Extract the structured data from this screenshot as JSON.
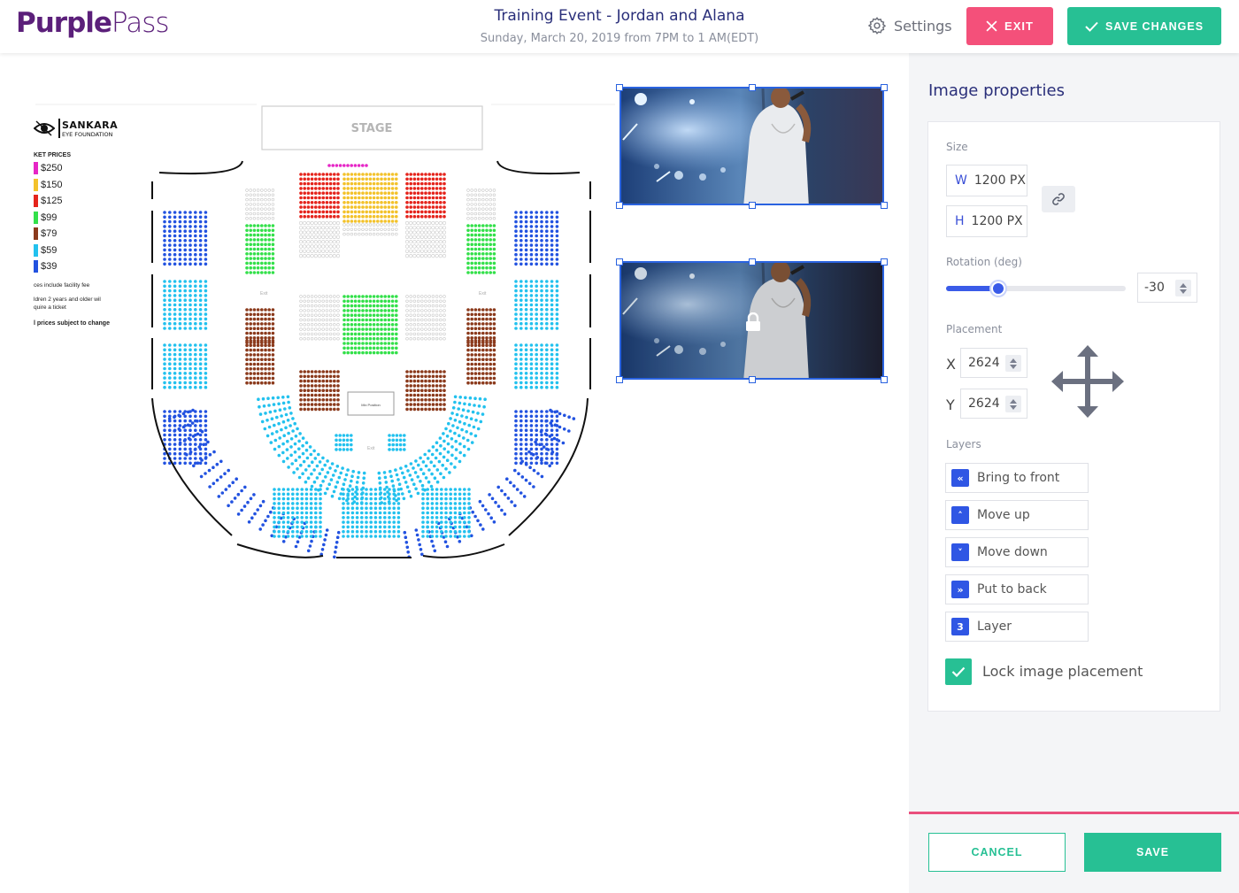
{
  "header": {
    "logo_part1": "Purple",
    "logo_part2": "Pass",
    "event_title": "Training Event - Jordan and Alana",
    "event_subtitle": "Sunday, March 20, 2019 from 7PM to 1 AM(EDT)",
    "settings_label": "Settings",
    "exit_label": "EXIT",
    "save_changes_label": "SAVE CHANGES"
  },
  "map": {
    "stage_label": "STAGE",
    "org_name": "SANKARA",
    "org_sub": "EYE FOUNDATION",
    "prices_heading": "KET PRICES",
    "price_tiers": [
      {
        "label": "$250",
        "color": "#e626c6"
      },
      {
        "label": "$150",
        "color": "#f3c22b"
      },
      {
        "label": "$125",
        "color": "#e5241c"
      },
      {
        "label": "$99",
        "color": "#33e04a"
      },
      {
        "label": "$79",
        "color": "#8b3a1c"
      },
      {
        "label": "$59",
        "color": "#22c1ee"
      },
      {
        "label": "$39",
        "color": "#2252e0"
      }
    ],
    "note1": "ces include facility fee",
    "note2a": "ldren 2 years and older wil",
    "note2b": "quire a ticket",
    "note3": "l prices subject to change",
    "mix_position": "Mix Position",
    "exit_labels": [
      "Exit",
      "Exit",
      "Exit"
    ]
  },
  "panel": {
    "title": "Image properties",
    "size_label": "Size",
    "width_key": "W",
    "width_value": "1200 PX",
    "height_key": "H",
    "height_value": "1200 PX",
    "rotation_label": "Rotation (deg)",
    "rotation_value": "-30",
    "rotation_slider_percent": 29,
    "placement_label": "Placement",
    "x_key": "X",
    "x_value": "2624",
    "y_key": "Y",
    "y_value": "2624",
    "layers_label": "Layers",
    "layer_buttons": [
      {
        "icon": "«",
        "label": "Bring to front"
      },
      {
        "icon": "˄",
        "label": "Move up"
      },
      {
        "icon": "˅",
        "label": "Move down"
      },
      {
        "icon": "»",
        "label": "Put to back"
      },
      {
        "icon": "3",
        "label": "Layer"
      }
    ],
    "lock_label": "Lock image placement",
    "lock_checked": true,
    "cancel_label": "CANCEL",
    "save_label": "SAVE"
  },
  "colors": {
    "brand_purple": "#5b1f7a",
    "accent_green": "#27c094",
    "exit_pink": "#f4507a",
    "selection_blue": "#2a63e0"
  }
}
